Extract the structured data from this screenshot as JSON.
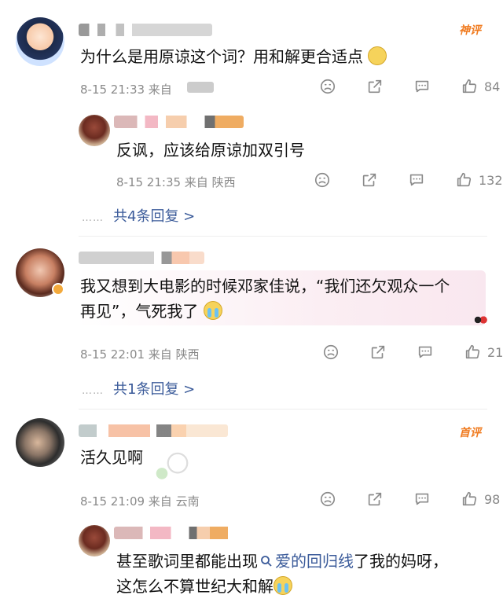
{
  "comments": [
    {
      "badge": "神评",
      "text": "为什么是用原谅这个词？用和解更合适点",
      "meta": "8-15 21:33 来自",
      "likes": "84",
      "reply": {
        "text": "反讽，应该给原谅加双引号",
        "meta": "8-15 21:35 来自 陕西",
        "likes": "132"
      },
      "replies_link": "共4条回复 >"
    },
    {
      "text_line1": "我又想到大电影的时候邓家佳说，“我们还欠观众一个",
      "text_line2": "再见”，气死我了",
      "meta": "8-15 22:01 来自 陕西",
      "likes": "21",
      "replies_link": "共1条回复 >"
    },
    {
      "badge": "首评",
      "text": "活久见啊",
      "meta": "8-15 21:09 来自 云南",
      "likes": "98",
      "reply": {
        "text_pre": "甚至歌词里都能出现",
        "link_icon": "search-icon",
        "link_text": "爱的回归线",
        "text_post": "了我的妈呀，",
        "text_line2": "这怎么不算世纪大和解"
      }
    }
  ],
  "colors": {
    "link": "#3b5b9a",
    "badge": "#f07a1e",
    "meta": "#8a8a8a"
  }
}
